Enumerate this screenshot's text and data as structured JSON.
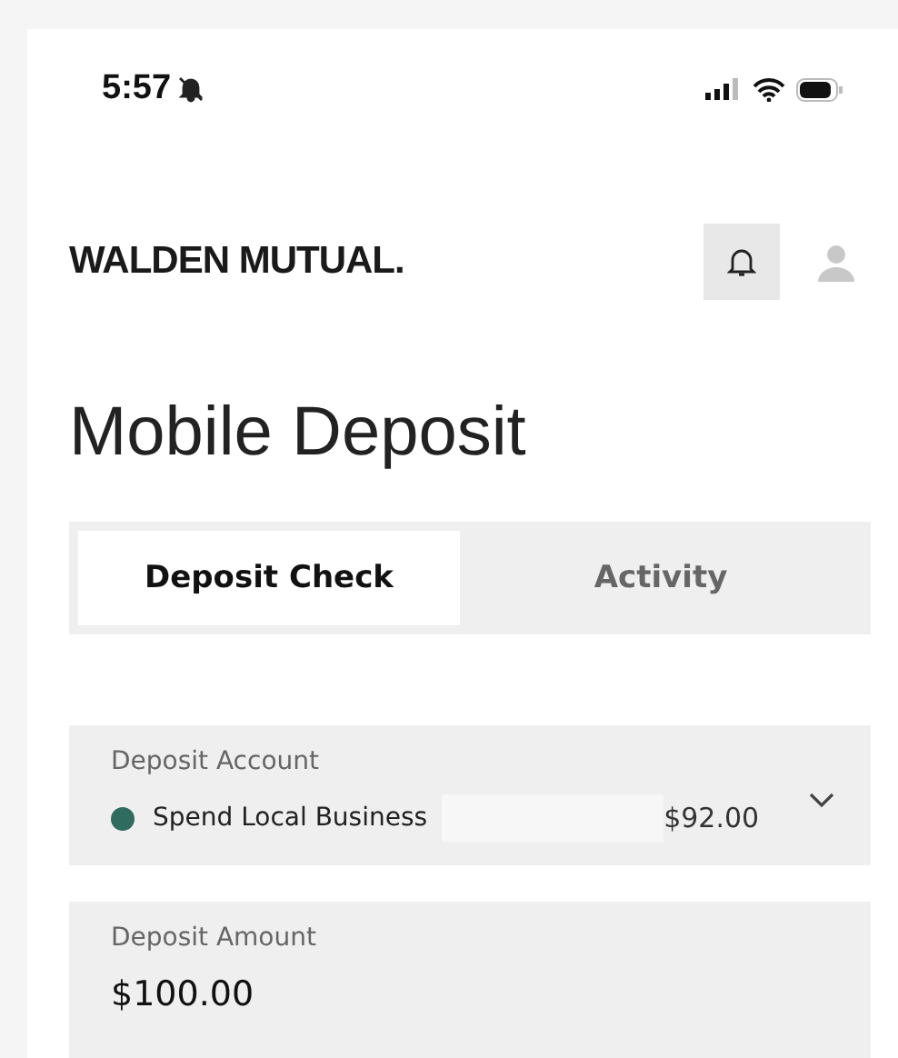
{
  "status_bar": {
    "time": "5:57"
  },
  "header": {
    "logo": "WALDEN MUTUAL."
  },
  "title": "Mobile Deposit",
  "tabs": [
    {
      "label": "Deposit Check",
      "selected": true
    },
    {
      "label": "Activity",
      "selected": false
    }
  ],
  "deposit_account": {
    "label": "Deposit Account",
    "account": "Spend Local Business",
    "color": "#2f6b5f",
    "balance": "$92.00"
  },
  "deposit_amount": {
    "label": "Deposit Amount",
    "value": "$100.00"
  }
}
